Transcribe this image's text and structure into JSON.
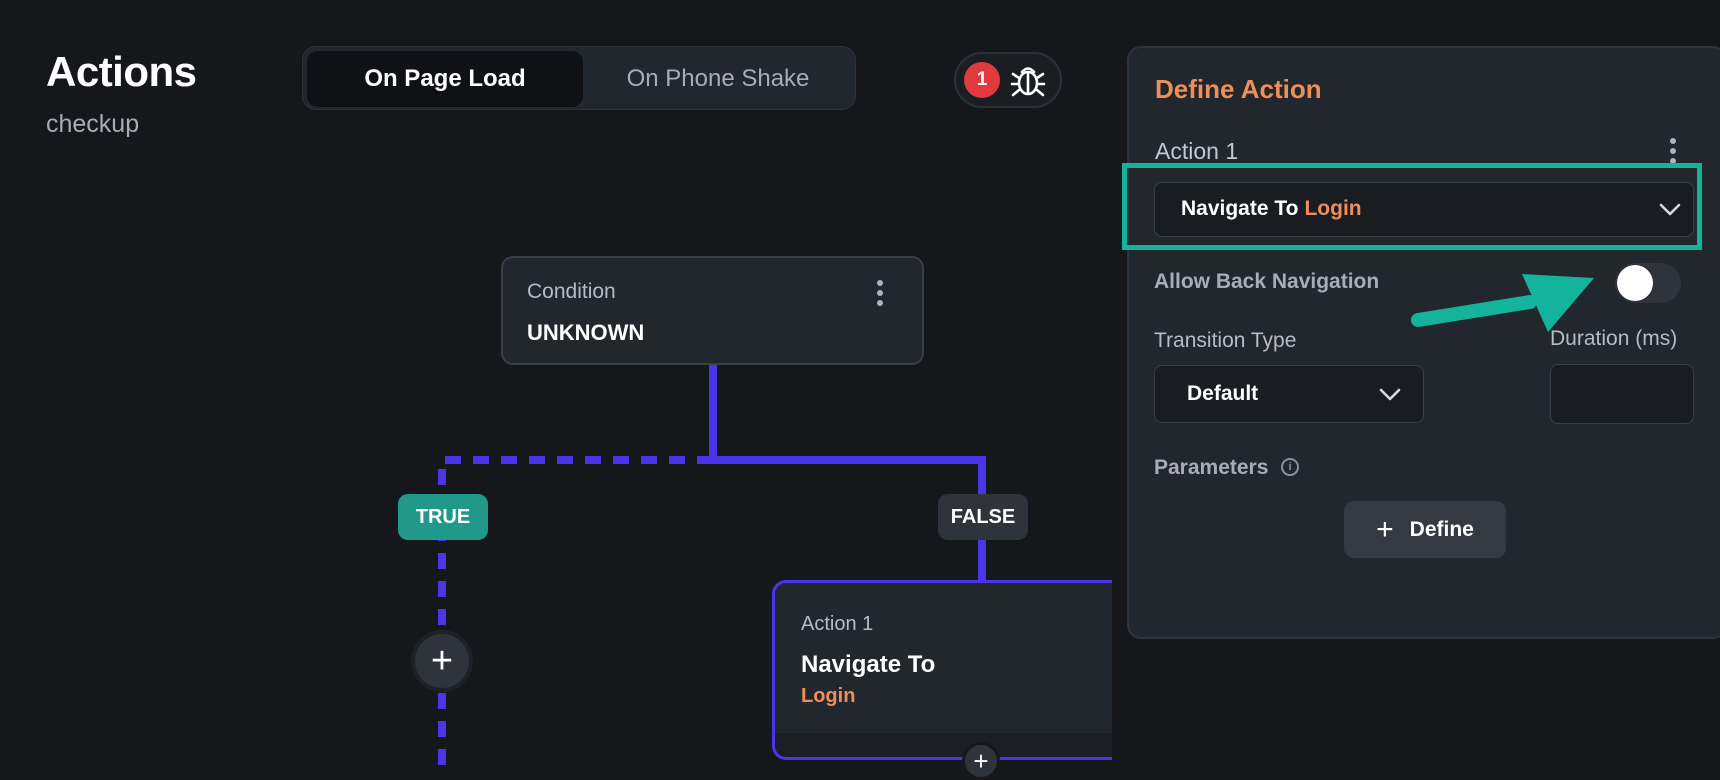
{
  "header": {
    "title": "Actions",
    "subtitle": "checkup",
    "tabs": [
      {
        "label": "On Page Load",
        "active": true
      },
      {
        "label": "On Phone Shake",
        "active": false
      }
    ],
    "debug": {
      "badge_count": "1",
      "icon": "bug-icon"
    }
  },
  "canvas": {
    "condition": {
      "label": "Condition",
      "value": "UNKNOWN"
    },
    "true_label": "TRUE",
    "false_label": "FALSE",
    "add_symbol": "+",
    "action_card": {
      "label": "Action 1",
      "title": "Navigate To",
      "value": "Login"
    }
  },
  "panel": {
    "title": "Define Action",
    "action_label": "Action 1",
    "action_select": {
      "prefix": "Navigate To",
      "value": "Login"
    },
    "allow_back_navigation": {
      "label": "Allow Back Navigation",
      "enabled": false
    },
    "transition_type": {
      "label": "Transition Type",
      "value": "Default"
    },
    "duration": {
      "label": "Duration (ms)",
      "value": ""
    },
    "parameters": {
      "label": "Parameters",
      "info_icon": "info-icon"
    },
    "define_button": {
      "label": "Define",
      "icon": "plus-icon"
    }
  },
  "colors": {
    "background": "#15171b",
    "panel": "#22262d",
    "accent_orange": "#ee8e5b",
    "connector_blue": "#4a35e8",
    "teal": "#14b39b",
    "badge_red": "#e03a3e"
  }
}
